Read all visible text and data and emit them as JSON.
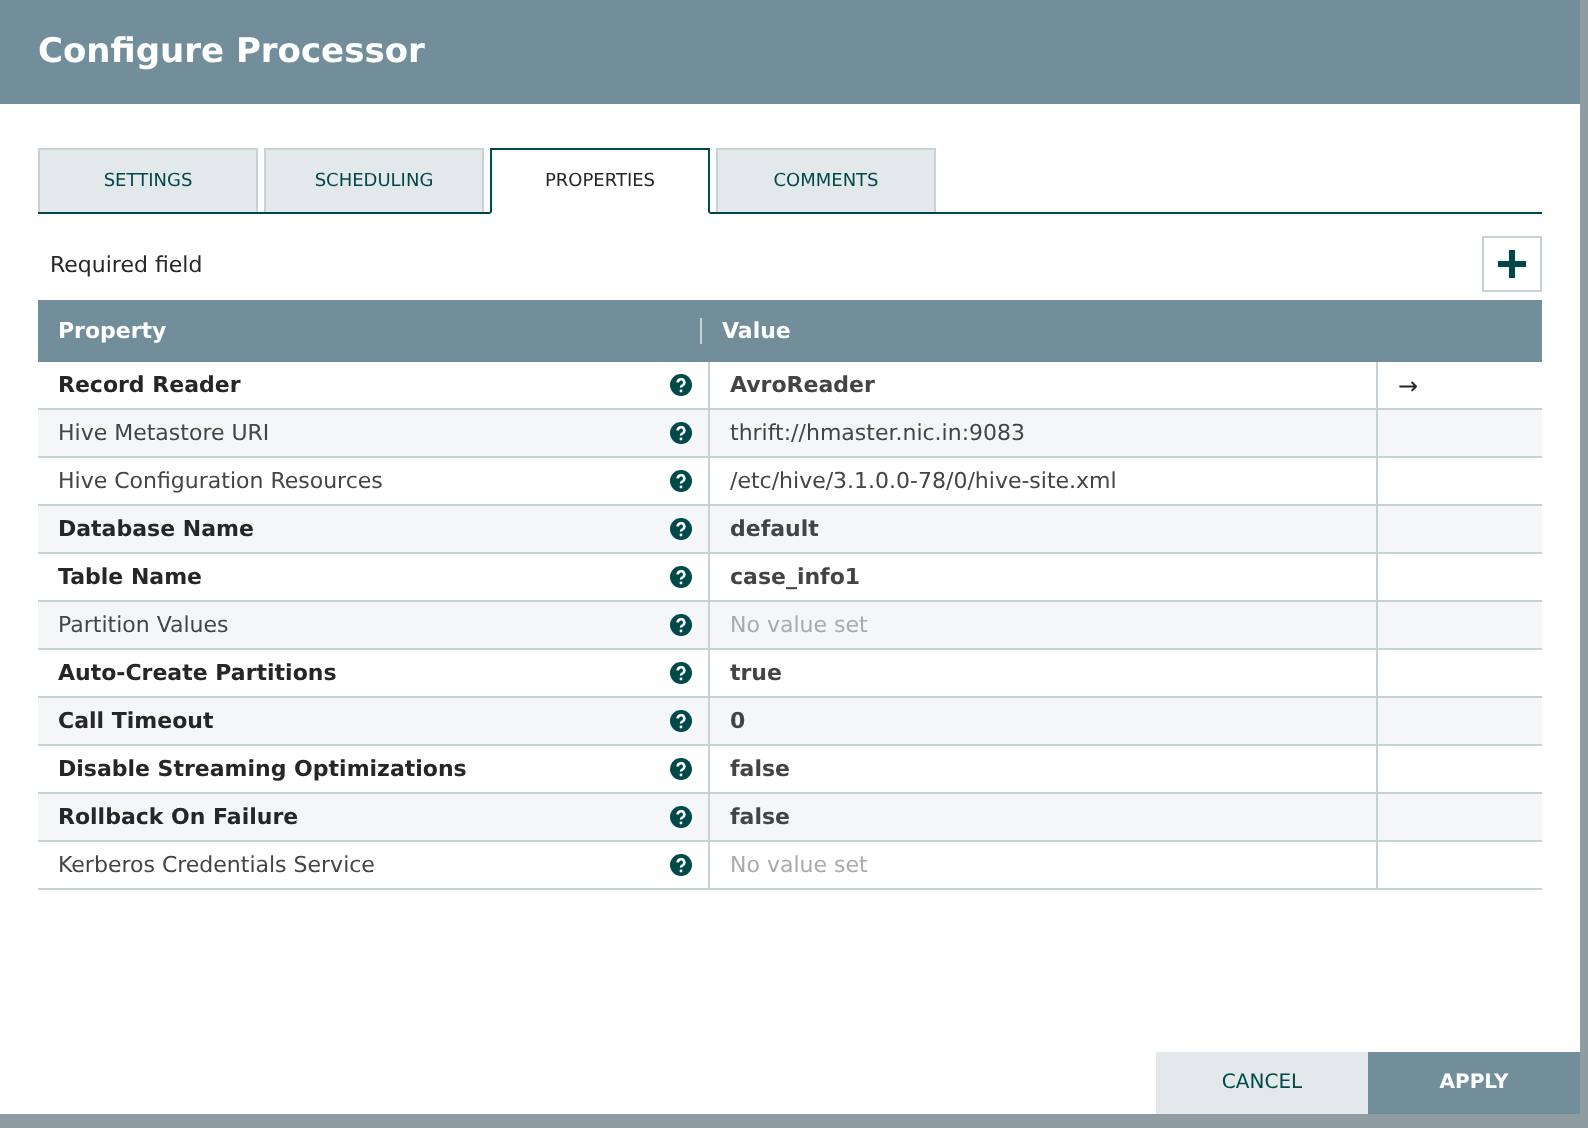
{
  "window": {
    "title": "Configure Processor"
  },
  "tabs": [
    {
      "label": "SETTINGS",
      "selected": false
    },
    {
      "label": "SCHEDULING",
      "selected": false
    },
    {
      "label": "PROPERTIES",
      "selected": true
    },
    {
      "label": "COMMENTS",
      "selected": false
    }
  ],
  "required_note": "Required field",
  "table": {
    "columns": [
      "Property",
      "Value"
    ],
    "rows": [
      {
        "name": "Record Reader",
        "required": true,
        "value": "AvroReader",
        "action": "→"
      },
      {
        "name": "Hive Metastore URI",
        "required": false,
        "value": "thrift://hmaster.nic.in:9083"
      },
      {
        "name": "Hive Configuration Resources",
        "required": false,
        "value": "/etc/hive/3.1.0.0-78/0/hive-site.xml"
      },
      {
        "name": "Database Name",
        "required": true,
        "value": "default"
      },
      {
        "name": "Table Name",
        "required": true,
        "value": "case_info1"
      },
      {
        "name": "Partition Values",
        "required": false,
        "placeholder": "No value set"
      },
      {
        "name": "Auto-Create Partitions",
        "required": true,
        "value": "true"
      },
      {
        "name": "Call Timeout",
        "required": true,
        "value": "0"
      },
      {
        "name": "Disable Streaming Optimizations",
        "required": true,
        "value": "false"
      },
      {
        "name": "Rollback On Failure",
        "required": true,
        "value": "false"
      },
      {
        "name": "Kerberos Credentials Service",
        "required": false,
        "placeholder": "No value set"
      }
    ]
  },
  "buttons": [
    {
      "label": "CANCEL",
      "kind": "secondary"
    },
    {
      "label": "APPLY",
      "kind": "primary"
    }
  ]
}
